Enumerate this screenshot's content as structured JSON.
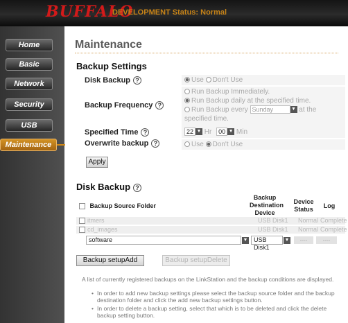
{
  "header": {
    "logo": "BUFFALO",
    "status": "DEVELOPMENT Status: Normal"
  },
  "sidebar": {
    "items": [
      {
        "label": "Home"
      },
      {
        "label": "Basic"
      },
      {
        "label": "Network"
      },
      {
        "label": "Security"
      },
      {
        "label": "USB"
      },
      {
        "label": "Maintenance"
      }
    ],
    "active": "Maintenance"
  },
  "page": {
    "title": "Maintenance"
  },
  "backup_settings": {
    "title": "Backup Settings",
    "help_glyph": "?",
    "disk_backup": {
      "label": "Disk Backup",
      "options": [
        "Use",
        "Don't Use"
      ],
      "selected": "Use"
    },
    "frequency": {
      "label": "Backup Frequency",
      "opt1": "Run Backup Immediately.",
      "opt2": "Run Backup daily at the specified time.",
      "opt3a": "Run Backup every",
      "weekday": "Sunday",
      "opt3b": "at the",
      "opt3c": "specified time.",
      "selected": "Run Backup daily at the specified time."
    },
    "time": {
      "label": "Specified Time",
      "hour": "22",
      "hour_unit": "Hr",
      "minute": "00",
      "minute_unit": "Min"
    },
    "overwrite": {
      "label": "Overwrite backup",
      "options": [
        "Use",
        "Don't Use"
      ],
      "selected": "Don't Use"
    },
    "apply_label": "Apply"
  },
  "disk_backup": {
    "title": "Disk Backup",
    "columns": {
      "source": "Backup Source Folder",
      "destination": "Backup Destination Device",
      "status": "Device Status",
      "log": "Log"
    },
    "rows": [
      {
        "source": "itmers",
        "destination": "USB Disk1",
        "status": "Normal",
        "log": "Complete"
      },
      {
        "source": "cd_images",
        "destination": "USB Disk1",
        "status": "Normal",
        "log": "Complete"
      }
    ],
    "new_row": {
      "source": "software",
      "destination": "USB Disk1",
      "status": "----",
      "log": "----"
    },
    "add_label": "Backup setupAdd",
    "delete_label": "Backup setupDelete",
    "intro": "A list of currently registered backups on the LinkStation and the backup conditions are displayed.",
    "bullets": [
      "In order to add new backup settings please select the backup source folder and the backup destination folder and click the add new backup settings button.",
      "In order to delete a backup setting, select that which is to be deleted and click the delete backup setting button."
    ]
  },
  "colors": {
    "accent": "#d38a16",
    "logo": "#d31a1a",
    "header_status": "#c68318"
  }
}
